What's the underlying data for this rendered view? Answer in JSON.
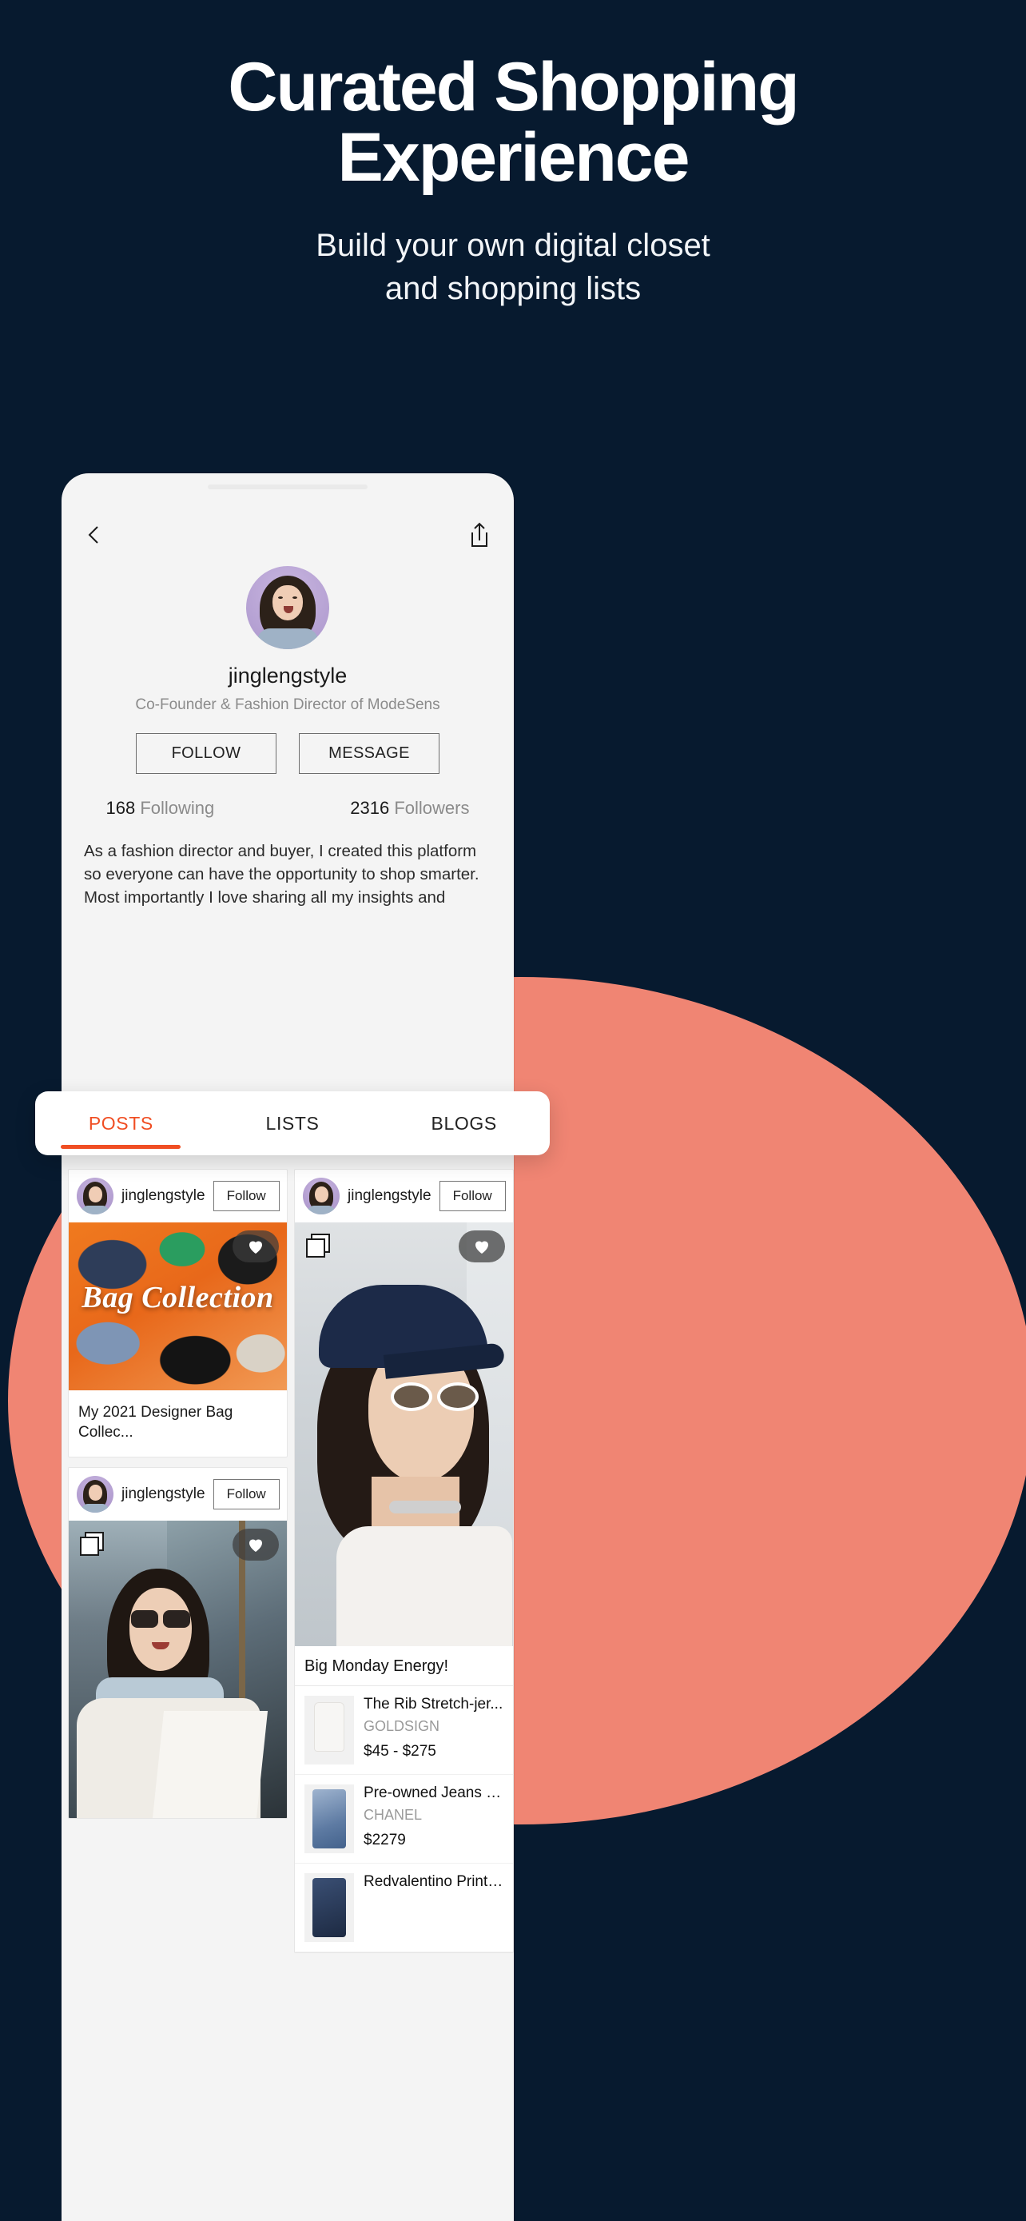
{
  "hero": {
    "title_line1": "Curated Shopping",
    "title_line2": "Experience",
    "subtitle_line1": "Build your own digital closet",
    "subtitle_line2": "and shopping lists"
  },
  "colors": {
    "background": "#071A2F",
    "accent": "#F04E23",
    "coral": "#F08573",
    "phone_bg": "#F4F4F4"
  },
  "phone": {
    "nav": {
      "back_icon": "chevron-left-icon",
      "share_icon": "share-icon"
    },
    "profile": {
      "username": "jinglengstyle",
      "tagline": "Co-Founder & Fashion Director of ModeSens",
      "follow_label": "FOLLOW",
      "message_label": "MESSAGE",
      "following_count": "168",
      "following_label": "Following",
      "followers_count": "2316",
      "followers_label": "Followers",
      "bio": "As a fashion director and buyer, I created this platform so everyone can have the opportunity to shop smarter. Most importantly I love sharing all my insights and luxury finds with yo..."
    },
    "tabs": [
      {
        "label": "POSTS",
        "active": true
      },
      {
        "label": "LISTS",
        "active": false
      },
      {
        "label": "BLOGS",
        "active": false
      }
    ],
    "feed": {
      "left": [
        {
          "author": "jinglengstyle",
          "follow_label": "Follow",
          "image_overlay_text": "Bag Collection",
          "title": "My 2021 Designer Bag Collec..."
        },
        {
          "author": "jinglengstyle",
          "follow_label": "Follow",
          "image_overlay_text": "",
          "title": ""
        }
      ],
      "right": [
        {
          "author": "jinglengstyle",
          "follow_label": "Follow",
          "blog_title": "Big Monday Energy!",
          "products": [
            {
              "name": "The Rib Stretch-jer...",
              "brand": "GOLDSIGN",
              "price": "$45 - $275"
            },
            {
              "name": "Pre-owned Jeans In...",
              "brand": "CHANEL",
              "price": "$2279"
            },
            {
              "name": "Redvalentino Printe...",
              "brand": "",
              "price": ""
            }
          ]
        }
      ]
    }
  }
}
